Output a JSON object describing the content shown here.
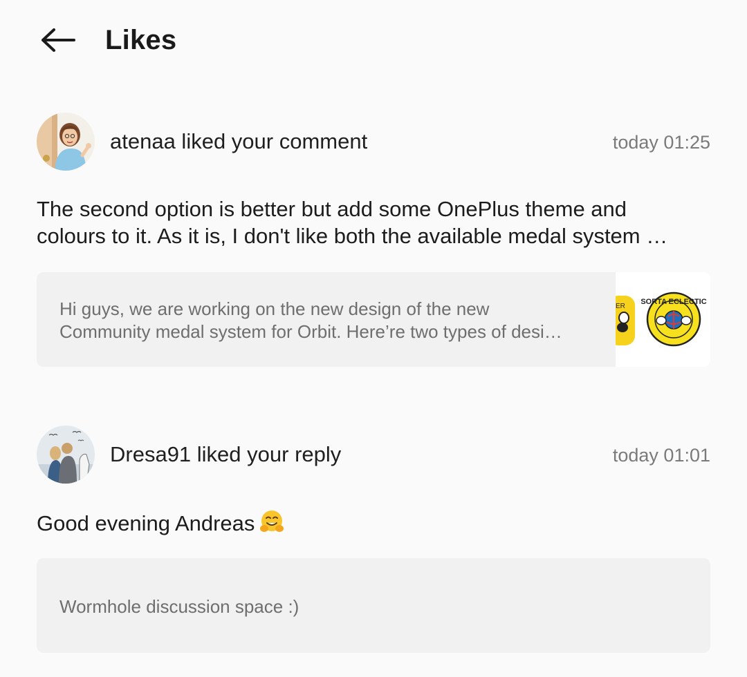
{
  "header": {
    "title": "Likes",
    "back_icon": "arrow-left-icon"
  },
  "notifications": [
    {
      "actor_line": "atenaa liked your comment",
      "time": "today 01:25",
      "comment_lines": [
        "The second option is better but add some OnePlus theme and",
        "colours to it. As it is, I don't like both the available medal system …"
      ],
      "quote_lines": [
        "Hi guys, we are working on the new design of the new",
        "Community medal system for Orbit. Here’re two types of desi…"
      ],
      "thumbnail_badge_text": "SORTA ECLECTIC",
      "thumbnail_partial_text": "ER"
    },
    {
      "actor_line": "Dresa91 liked your reply",
      "time": "today 01:01",
      "comment_text": "Good evening Andreas",
      "comment_emoji": "hugging-face-emoji",
      "quote_text": "Wormhole discussion space :)"
    }
  ],
  "colors": {
    "background": "#fafafa",
    "card": "#f1f1f1",
    "text_primary": "#1f1f1f",
    "text_secondary": "#7a7a7a",
    "quote_text": "#6e6e6e"
  }
}
